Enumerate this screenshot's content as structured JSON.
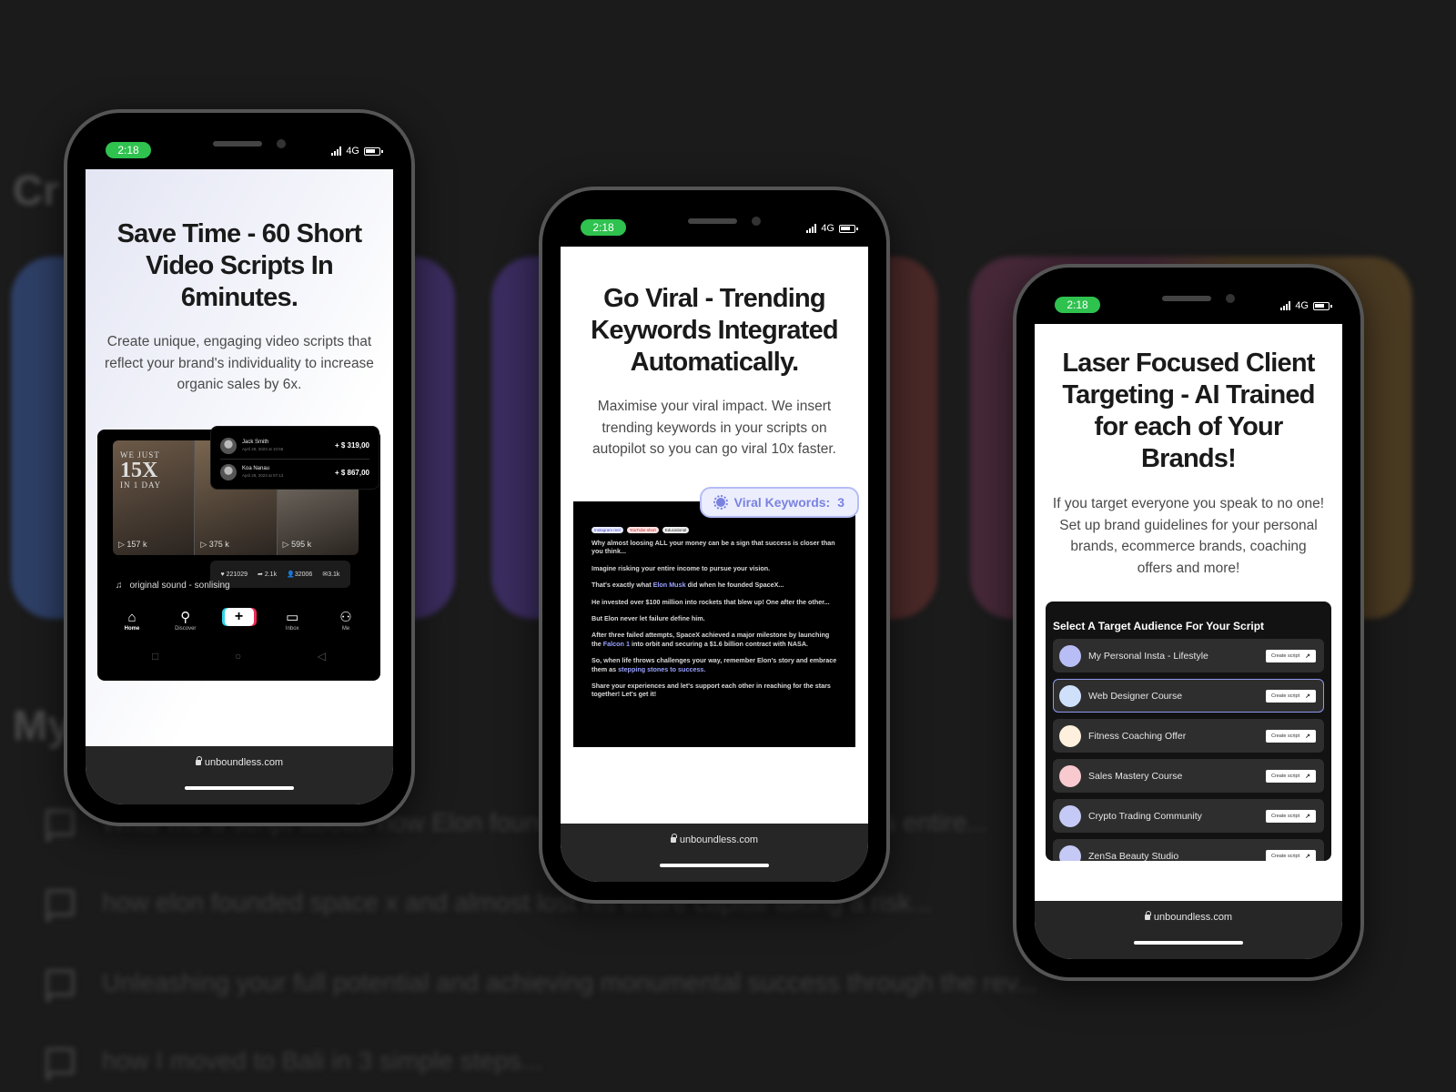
{
  "background": {
    "heading_top": "Cr",
    "heading_bottom": "My",
    "cards": [
      {
        "color": "#2e3f66"
      },
      {
        "color": "#3b2c5e"
      },
      {
        "color": "#3a2c5e"
      },
      {
        "color": "#4a2828"
      },
      {
        "color": "#462838"
      },
      {
        "color": "#4a3a22"
      }
    ],
    "history": [
      "Write me a script about: how Elon founded SpaceX and almost lost his entire...",
      "how elon founded space x and almost lost his entire capital taking a risk...",
      "Unleashing your full potential and achieving monumental success through the rev...",
      "how I moved to Bali in 3 simple steps..."
    ]
  },
  "status_bar": {
    "time": "2:18",
    "network": "4G"
  },
  "browser": {
    "url": "unboundless.com"
  },
  "phones": [
    {
      "headline": "Save Time - 60 Short Video Scripts In 6minutes.",
      "subtext": "Create unique, engaging video scripts that reflect your brand's individuality to increase organic sales by 6x.",
      "mockup": {
        "overlay": {
          "small": "WE JUST",
          "big": "15X",
          "small2": "IN 1 DAY"
        },
        "thumbnails": [
          {
            "views": "157 k",
            "color": "#6d5a48"
          },
          {
            "views": "375 k",
            "color": "#7a6650"
          },
          {
            "views": "595 k",
            "color": "#8a8278"
          }
        ],
        "sales": [
          {
            "name": "Jack Smith",
            "date": "April 28, 2023 at 10:58",
            "amount": "+ $ 319,00"
          },
          {
            "name": "Koa Nanau",
            "date": "April 28, 2023 at 07:13",
            "amount": "+ $ 867,00"
          }
        ],
        "stats": {
          "likes": "221029",
          "shares": "2.1k",
          "followers": "32006",
          "messages": "3.1k"
        },
        "sound": "original sound - sonlising",
        "tabs": [
          {
            "label": "Home",
            "icon": "house"
          },
          {
            "label": "Discover",
            "icon": "search"
          },
          {
            "label": "",
            "icon": "plus"
          },
          {
            "label": "Inbox",
            "icon": "inbox"
          },
          {
            "label": "Me",
            "icon": "person"
          }
        ]
      }
    },
    {
      "headline": "Go Viral - Trending Keywords Integrated Automatically.",
      "subtext": "Maximise your viral impact. We insert trending keywords in your scripts on autopilot so you can go viral 10x faster.",
      "badge": {
        "label": "Viral Keywords:",
        "count": "3"
      },
      "chips": [
        "Instagram reel",
        "YouTube short",
        "Educational"
      ],
      "script": [
        {
          "before": "Why almost loosing ALL your money can be a sign that success is closer than you think...",
          "hl": "",
          "after": ""
        },
        {
          "before": "Imagine risking your entire income to pursue your vision.",
          "hl": "",
          "after": ""
        },
        {
          "before": "That's exactly what ",
          "hl": "Elon Musk",
          "after": " did when he founded SpaceX..."
        },
        {
          "before": "He invested over $100 million into rockets that blew up! One after the other...",
          "hl": "",
          "after": ""
        },
        {
          "before": "But Elon never let failure define him.",
          "hl": "",
          "after": ""
        },
        {
          "before": "After three failed attempts, SpaceX achieved a major milestone by launching the ",
          "hl": "Falcon 1",
          "after": " into orbit and securing a $1.6 billion contract with NASA."
        },
        {
          "before": "So, when life throws challenges your way, remember Elon's story and embrace them as ",
          "hl": "stepping stones to success.",
          "after": ""
        },
        {
          "before": "Share your experiences and let's support each other in reaching for the stars together! Let's get it!",
          "hl": "",
          "after": ""
        }
      ]
    },
    {
      "headline": "Laser Focused Client Targeting - AI Trained for each of Your Brands!",
      "subtext": "If you target everyone you speak to no one! Set up brand guidelines for your personal brands, ecommerce brands, coaching offers and more!",
      "audience_title": "Select A Target Audience For Your Script",
      "create_label": "Create script",
      "audiences": [
        {
          "name": "My Personal Insta - Lifestyle",
          "color": "#b9bdf5",
          "selected": false
        },
        {
          "name": "Web Designer Course",
          "color": "#cfe0fb",
          "selected": true
        },
        {
          "name": "Fitness Coaching Offer",
          "color": "#fdf0dc",
          "selected": false
        },
        {
          "name": "Sales Mastery Course",
          "color": "#f8c9cf",
          "selected": false
        },
        {
          "name": "Crypto Trading Community",
          "color": "#c4c9f5",
          "selected": false
        },
        {
          "name": "ZenSa Beauty Studio",
          "color": "#c4c9f5",
          "selected": false
        }
      ]
    }
  ]
}
